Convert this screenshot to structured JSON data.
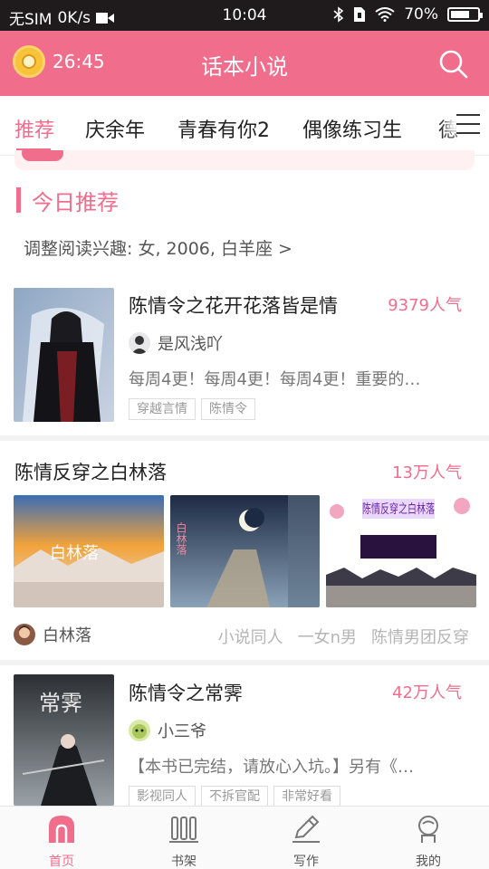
{
  "status_bar": {
    "carrier": "无SIM",
    "speed": "0K/s",
    "time": "10:04",
    "battery": "70%",
    "battery_level": 0.7
  },
  "header": {
    "timer": "26:45",
    "title": "话本小说"
  },
  "tabs": [
    "推荐",
    "庆余年",
    "青春有你2",
    "偶像练习生",
    "德"
  ],
  "section": {
    "title": "今日推荐",
    "prefs": "调整阅读兴趣: 女, 2006, 白羊座 >"
  },
  "books": [
    {
      "title": "陈情令之花开花落皆是情",
      "popularity": "9379人气",
      "author": "是风浅吖",
      "description": "每周4更！每周4更！每周4更！重要的…",
      "tags": [
        "穿越言情",
        "陈情令"
      ]
    },
    {
      "title": "陈情反穿之白林落",
      "popularity": "13万人气",
      "author": "白林落",
      "tags": [
        "小说同人",
        "一女n男",
        "陈情男团反穿"
      ],
      "covers": [
        "白林落",
        "白林落",
        "陈情反穿之白林落"
      ]
    },
    {
      "title": "陈情令之常霁",
      "popularity": "42万人气",
      "author": "小三爷",
      "description": "【本书已完结，请放心入坑。】另有《…",
      "tags": [
        "影视同人",
        "不拆官配",
        "非常好看"
      ],
      "cover_text": "常霁"
    }
  ],
  "bottom_nav": [
    {
      "label": "首页",
      "icon": "home-icon",
      "active": true
    },
    {
      "label": "书架",
      "icon": "bookshelf-icon",
      "active": false
    },
    {
      "label": "写作",
      "icon": "pen-icon",
      "active": false
    },
    {
      "label": "我的",
      "icon": "profile-icon",
      "active": false
    }
  ],
  "colors": {
    "accent": "#f06d8c",
    "status_bar": "#1f1b1c"
  }
}
